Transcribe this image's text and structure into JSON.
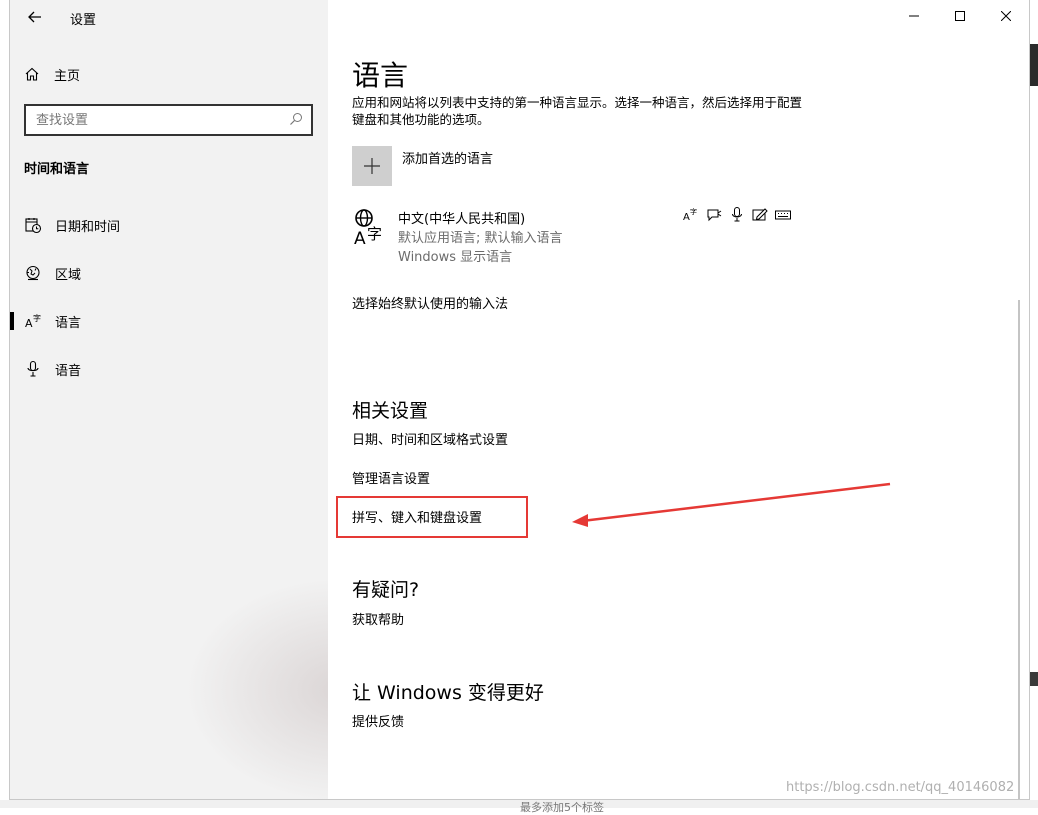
{
  "window": {
    "app_title": "设置",
    "controls": [
      "minimize-icon",
      "maximize-icon",
      "close-icon"
    ]
  },
  "sidebar": {
    "home_label": "主页",
    "search_placeholder": "查找设置",
    "section_title": "时间和语言",
    "items": [
      {
        "label": "日期和时间",
        "icon": "calendar-clock-icon",
        "selected": false
      },
      {
        "label": "区域",
        "icon": "globe-region-icon",
        "selected": false
      },
      {
        "label": "语言",
        "icon": "language-icon",
        "selected": true
      },
      {
        "label": "语音",
        "icon": "microphone-icon",
        "selected": false
      }
    ]
  },
  "main": {
    "title": "语言",
    "description": "应用和网站将以列表中支持的第一种语言显示。选择一种语言，然后选择用于配置键盘和其他功能的选项。",
    "add_language_label": "添加首选的语言",
    "language": {
      "name": "中文(中华人民共和国)",
      "sub1": "默认应用语言; 默认输入语言",
      "sub2": "Windows 显示语言",
      "feature_icons": [
        "display-language-icon",
        "text-to-speech-icon",
        "speech-recognition-icon",
        "handwriting-icon",
        "keyboard-icon"
      ]
    },
    "choose_ime": "选择始终默认使用的输入法",
    "related": {
      "title": "相关设置",
      "links": [
        "日期、时间和区域格式设置",
        "管理语言设置",
        "拼写、键入和键盘设置"
      ]
    },
    "question": {
      "title": "有疑问?",
      "link": "获取帮助"
    },
    "improve": {
      "title": "让 Windows 变得更好",
      "link": "提供反馈"
    }
  },
  "annotation": {
    "color": "#e53935"
  },
  "watermark": "https://blog.csdn.net/qq_40146082",
  "bottom_text": "最多添加5个标签"
}
